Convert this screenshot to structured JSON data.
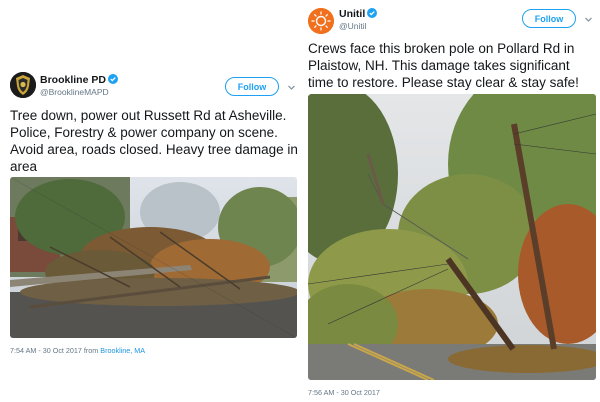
{
  "tweets": [
    {
      "display_name": "Brookline PD",
      "handle": "@BrooklineMAPD",
      "follow_label": "Follow",
      "text": "Tree down, power out Russett Rd at Asheville. Police, Forestry & power company on scene. Avoid area, roads closed. Heavy tree damage in area",
      "timestamp": "7:54 AM - 30 Oct 2017 from ",
      "location": "Brookline, MA",
      "avatar_icon": "police-badge-icon"
    },
    {
      "display_name": "Unitil",
      "handle": "@Unitil",
      "follow_label": "Follow",
      "text": "Crews face this broken pole on Pollard Rd in Plaistow, NH. This damage takes significant time to restore. Please stay clear & stay safe!",
      "timestamp": "7:56 AM - 30 Oct 2017",
      "avatar_icon": "sun-logo-icon"
    }
  ],
  "colors": {
    "accent": "#1da1f2",
    "link": "#1b95e0",
    "muted": "#657786",
    "unitil_orange": "#f0701e"
  }
}
